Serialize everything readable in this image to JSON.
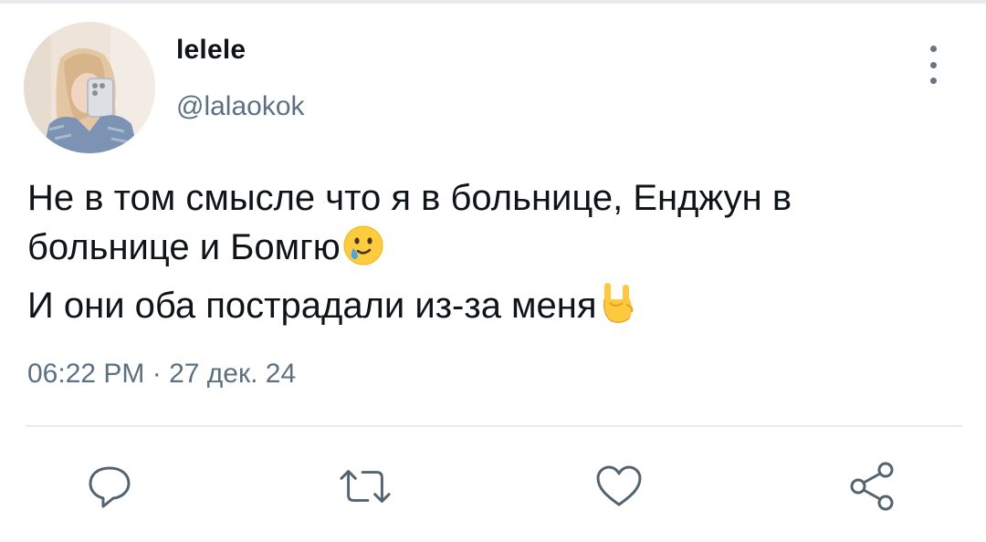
{
  "user": {
    "display_name": "lelele",
    "handle": "@lalaokok",
    "avatar_icon": "avatar-photo"
  },
  "menu": {
    "icon": "more-vertical-icon"
  },
  "tweet": {
    "line1": "Не в том смысле что я в больнице, Енджун в",
    "line2": "больнице и Бомгю",
    "line2_emoji": "smiling-face-with-tear-icon",
    "line3": "И они оба пострадали из-за меня",
    "line3_emoji": "sign-of-the-horns-icon"
  },
  "timestamp": "06:22 PM · 27 дек. 24",
  "actions": [
    {
      "name": "reply",
      "icon": "reply-icon"
    },
    {
      "name": "retweet",
      "icon": "retweet-icon"
    },
    {
      "name": "like",
      "icon": "heart-icon"
    },
    {
      "name": "share",
      "icon": "share-icon"
    }
  ],
  "colors": {
    "text": "#0f1419",
    "secondary": "#5b7083",
    "icon": "#536471",
    "divider": "#e6ecf0"
  }
}
